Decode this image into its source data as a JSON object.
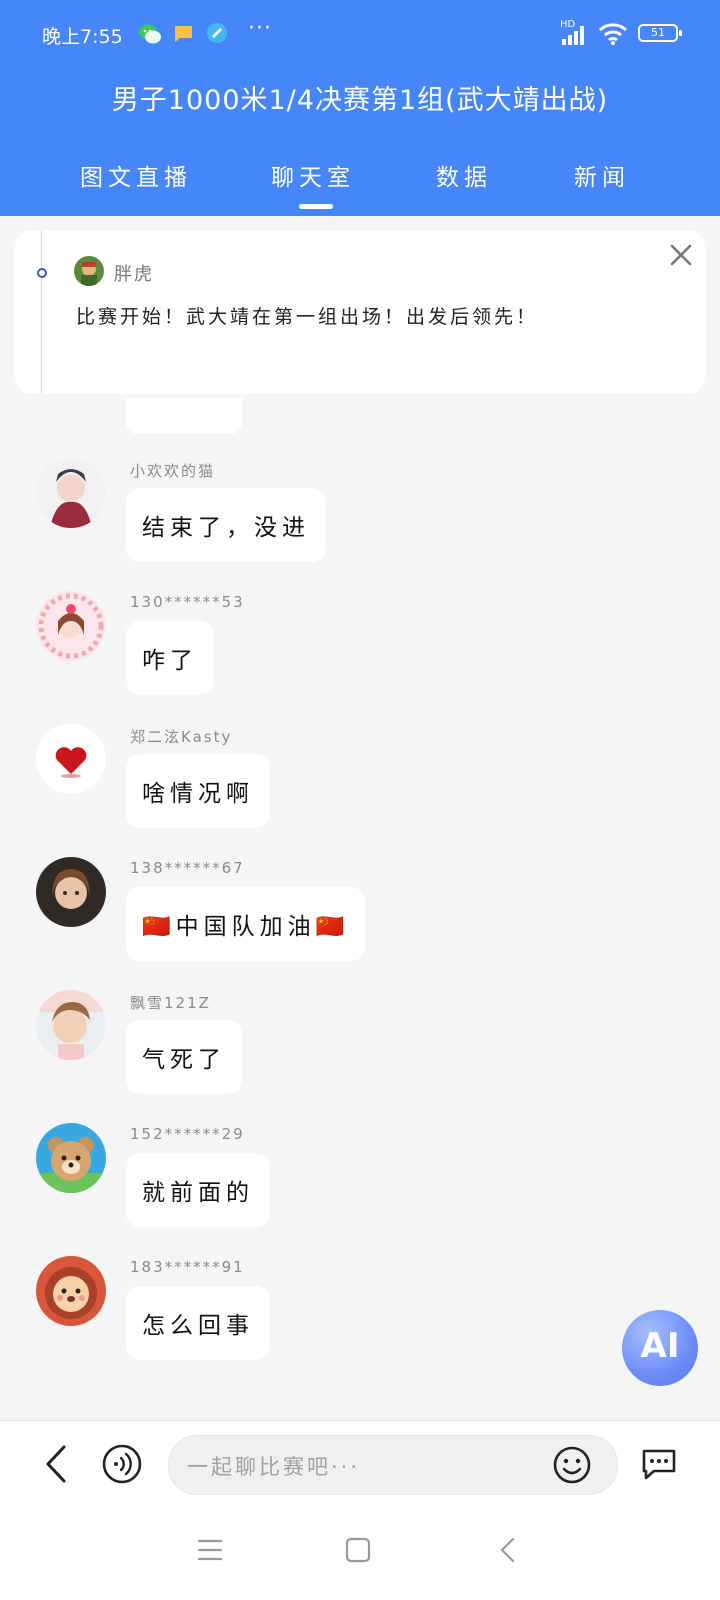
{
  "status_bar": {
    "time": "晚上7:55",
    "battery": "51",
    "network": "HD"
  },
  "header": {
    "title": "男子1000米1/4决赛第1组(武大靖出战)"
  },
  "tabs": [
    {
      "label": "图文直播"
    },
    {
      "label": "聊天室",
      "active": true
    },
    {
      "label": "数据"
    },
    {
      "label": "新闻"
    }
  ],
  "pinned": {
    "username": "胖虎",
    "text": "比赛开始！武大靖在第一组出场！出发后领先！"
  },
  "messages": [
    {
      "username": "小欢欢的猫",
      "text": "结束了，没进",
      "avatar": "anime-boy-avatar"
    },
    {
      "username": "130******53",
      "text": "咋了",
      "avatar": "anime-girl-avatar"
    },
    {
      "username": "郑二泫Kasty",
      "text": "啥情况啊",
      "avatar": "red-heart-avatar"
    },
    {
      "username": "138******67",
      "text": "🇨🇳中国队加油🇨🇳",
      "avatar": "doll-avatar"
    },
    {
      "username": "飘雪121Z",
      "text": "气死了",
      "avatar": "child-avatar"
    },
    {
      "username": "152******29",
      "text": "就前面的",
      "avatar": "bear-avatar"
    },
    {
      "username": "183******91",
      "text": "怎么回事",
      "avatar": "lion-avatar"
    }
  ],
  "ai_button": {
    "label": "AI"
  },
  "input": {
    "placeholder": "一起聊比赛吧···"
  },
  "colors": {
    "accent": "#4786f9",
    "bubble": "#ffffff",
    "background": "#f5f5f7"
  }
}
